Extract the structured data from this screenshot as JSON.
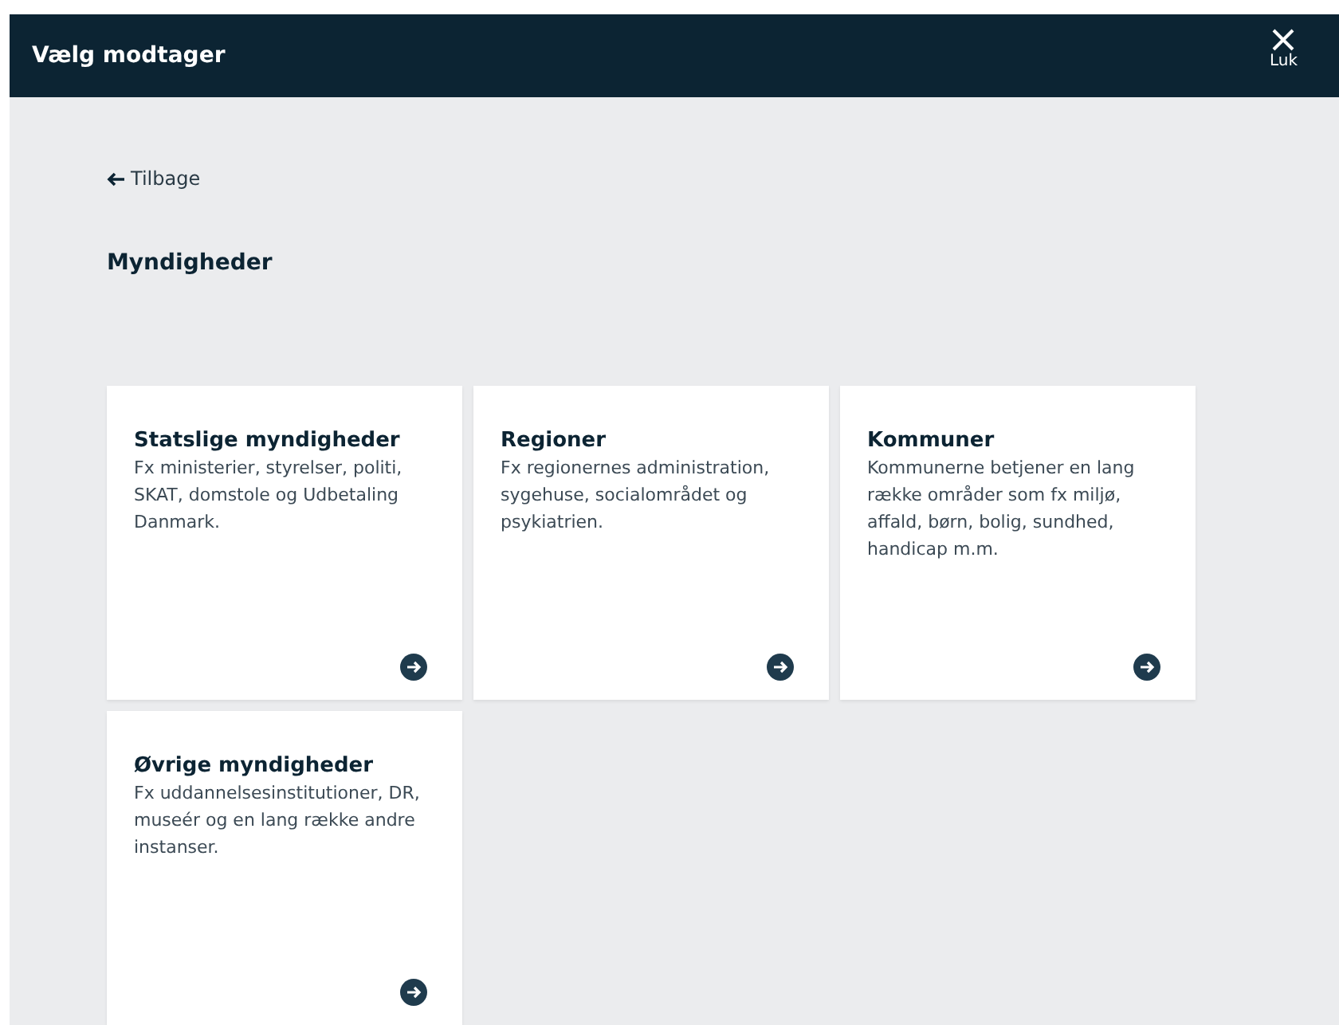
{
  "header": {
    "title": "Vælg modtager",
    "close_label": "Luk"
  },
  "back_link": {
    "label": "Tilbage"
  },
  "heading": "Myndigheder",
  "cards": [
    {
      "title": "Statslige myndigheder",
      "description": "Fx ministerier, styrelser, politi, SKAT, domstole og Udbetaling Danmark."
    },
    {
      "title": "Regioner",
      "description": "Fx regionernes administration, sygehuse, socialområdet og psykiatrien."
    },
    {
      "title": "Kommuner",
      "description": "Kommunerne betjener en lang række områder som fx miljø, affald, børn, bolig, sundhed, handicap m.m."
    },
    {
      "title": "Øvrige myndigheder",
      "description": "Fx uddannelsesinstitutioner, DR, museér og en lang række andre instanser."
    }
  ]
}
